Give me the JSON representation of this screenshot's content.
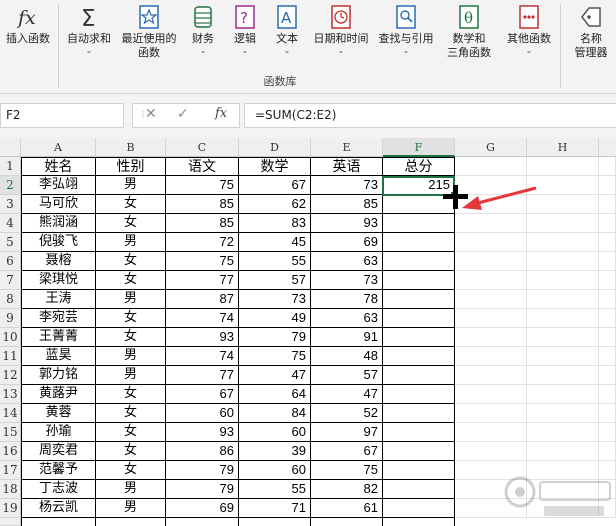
{
  "ribbon": {
    "buttons": [
      {
        "id": "insert-function",
        "label": "插入函数",
        "label2": "",
        "dropdown": false
      },
      {
        "id": "autosum",
        "label": "自动求和",
        "label2": "",
        "dropdown": true
      },
      {
        "id": "recently-used",
        "label": "最近使用的",
        "label2": "函数",
        "dropdown": true
      },
      {
        "id": "financial",
        "label": "财务",
        "label2": "",
        "dropdown": true
      },
      {
        "id": "logical",
        "label": "逻辑",
        "label2": "",
        "dropdown": true
      },
      {
        "id": "text",
        "label": "文本",
        "label2": "",
        "dropdown": true
      },
      {
        "id": "datetime",
        "label": "日期和时间",
        "label2": "",
        "dropdown": true
      },
      {
        "id": "lookup",
        "label": "查找与引用",
        "label2": "",
        "dropdown": true
      },
      {
        "id": "math",
        "label": "数学和",
        "label2": "三角函数",
        "dropdown": true
      },
      {
        "id": "more",
        "label": "其他函数",
        "label2": "",
        "dropdown": true
      },
      {
        "id": "name-manager",
        "label": "名称",
        "label2": "管理器",
        "dropdown": false
      }
    ],
    "group_label": "函数库"
  },
  "formula_bar": {
    "name_box": "F2",
    "formula": "=SUM(C2:E2)",
    "cancel": "✕",
    "enter": "✓",
    "fx": "fx"
  },
  "columns": [
    "A",
    "B",
    "C",
    "D",
    "E",
    "F",
    "G",
    "H"
  ],
  "selected_cell": "F2",
  "rows": [
    {
      "n": "1",
      "name": "姓名",
      "gender": "性别",
      "chinese": "语文",
      "math": "数学",
      "english": "英语",
      "total": "总分"
    },
    {
      "n": "2",
      "name": "李弘翊",
      "gender": "男",
      "chinese": "75",
      "math": "67",
      "english": "73",
      "total": "215"
    },
    {
      "n": "3",
      "name": "马可欣",
      "gender": "女",
      "chinese": "85",
      "math": "62",
      "english": "85",
      "total": ""
    },
    {
      "n": "4",
      "name": "熊润涵",
      "gender": "女",
      "chinese": "85",
      "math": "83",
      "english": "93",
      "total": ""
    },
    {
      "n": "5",
      "name": "倪骏飞",
      "gender": "男",
      "chinese": "72",
      "math": "45",
      "english": "69",
      "total": ""
    },
    {
      "n": "6",
      "name": "聂榕",
      "gender": "女",
      "chinese": "75",
      "math": "55",
      "english": "63",
      "total": ""
    },
    {
      "n": "7",
      "name": "梁琪悦",
      "gender": "女",
      "chinese": "77",
      "math": "57",
      "english": "73",
      "total": ""
    },
    {
      "n": "8",
      "name": "王涛",
      "gender": "男",
      "chinese": "87",
      "math": "73",
      "english": "78",
      "total": ""
    },
    {
      "n": "9",
      "name": "李宛芸",
      "gender": "女",
      "chinese": "74",
      "math": "49",
      "english": "63",
      "total": ""
    },
    {
      "n": "10",
      "name": "王菁菁",
      "gender": "女",
      "chinese": "93",
      "math": "79",
      "english": "91",
      "total": ""
    },
    {
      "n": "11",
      "name": "蓝昊",
      "gender": "男",
      "chinese": "74",
      "math": "75",
      "english": "48",
      "total": ""
    },
    {
      "n": "12",
      "name": "郭力铭",
      "gender": "男",
      "chinese": "77",
      "math": "47",
      "english": "57",
      "total": ""
    },
    {
      "n": "13",
      "name": "黄蕗尹",
      "gender": "女",
      "chinese": "67",
      "math": "64",
      "english": "47",
      "total": ""
    },
    {
      "n": "14",
      "name": "黄蓉",
      "gender": "女",
      "chinese": "60",
      "math": "84",
      "english": "52",
      "total": ""
    },
    {
      "n": "15",
      "name": "孙瑜",
      "gender": "女",
      "chinese": "93",
      "math": "60",
      "english": "97",
      "total": ""
    },
    {
      "n": "16",
      "name": "周奕君",
      "gender": "女",
      "chinese": "86",
      "math": "39",
      "english": "67",
      "total": ""
    },
    {
      "n": "17",
      "name": "范馨予",
      "gender": "女",
      "chinese": "79",
      "math": "60",
      "english": "75",
      "total": ""
    },
    {
      "n": "18",
      "name": "丁志波",
      "gender": "男",
      "chinese": "79",
      "math": "55",
      "english": "82",
      "total": ""
    },
    {
      "n": "19",
      "name": "杨云凯",
      "gender": "男",
      "chinese": "69",
      "math": "71",
      "english": "61",
      "total": ""
    }
  ],
  "colors": {
    "accent": "#217346",
    "arrow": "#e8373c"
  }
}
